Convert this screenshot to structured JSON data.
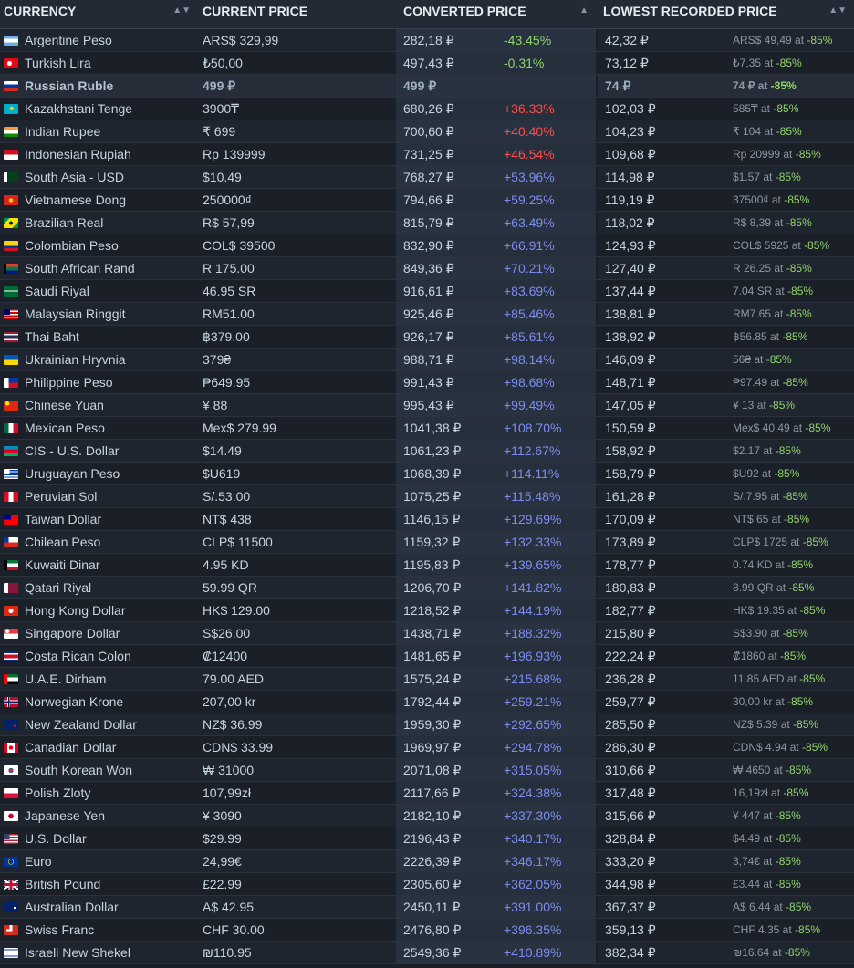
{
  "headers": {
    "currency": "CURRENCY",
    "current_price": "CURRENT PRICE",
    "converted_price": "CONVERTED PRICE",
    "lowest_recorded_price": "LOWEST RECORDED PRICE",
    "sort_both": "▲▼",
    "sort_asc": "▲"
  },
  "colors": {
    "discount_green": "#8fd46b",
    "increase_red": "#ff4d4d",
    "increase_blue": "#7d8cf0"
  },
  "rows": [
    {
      "flag": "argentina-flag",
      "currency": "Argentine Peso",
      "price": "ARS$ 329,99",
      "converted": "282,18 ₽",
      "diff": "-43.45%",
      "tone": "neg",
      "low": "42,32 ₽",
      "record": "ARS$ 49,49 at ",
      "disc": "-85%"
    },
    {
      "flag": "turkey-flag",
      "currency": "Turkish Lira",
      "price": "₺50,00",
      "converted": "497,43 ₽",
      "diff": "-0.31%",
      "tone": "neg",
      "low": "73,12 ₽",
      "record": "₺7,35 at ",
      "disc": "-85%"
    },
    {
      "flag": "russia-flag",
      "currency": "Russian Ruble",
      "price": "499 ₽",
      "converted": "499 ₽",
      "diff": "",
      "tone": "",
      "low": "74 ₽",
      "record": "74 ₽ at ",
      "disc": "-85%",
      "highlight": true
    },
    {
      "flag": "kazakhstan-flag",
      "currency": "Kazakhstani Tenge",
      "price": "3900₸",
      "converted": "680,26 ₽",
      "diff": "+36.33%",
      "tone": "pos",
      "low": "102,03 ₽",
      "record": "585₸ at ",
      "disc": "-85%"
    },
    {
      "flag": "india-flag",
      "currency": "Indian Rupee",
      "price": "₹ 699",
      "converted": "700,60 ₽",
      "diff": "+40.40%",
      "tone": "pos",
      "low": "104,23 ₽",
      "record": "₹ 104 at ",
      "disc": "-85%"
    },
    {
      "flag": "indonesia-flag",
      "currency": "Indonesian Rupiah",
      "price": "Rp 139999",
      "converted": "731,25 ₽",
      "diff": "+46.54%",
      "tone": "pos",
      "low": "109,68 ₽",
      "record": "Rp 20999 at ",
      "disc": "-85%"
    },
    {
      "flag": "pakistan-flag",
      "currency": "South Asia - USD",
      "price": "$10.49",
      "converted": "768,27 ₽",
      "diff": "+53.96%",
      "tone": "big",
      "low": "114,98 ₽",
      "record": "$1.57 at ",
      "disc": "-85%"
    },
    {
      "flag": "vietnam-flag",
      "currency": "Vietnamese Dong",
      "price": "250000₫",
      "converted": "794,66 ₽",
      "diff": "+59.25%",
      "tone": "big",
      "low": "119,19 ₽",
      "record": "37500₫ at ",
      "disc": "-85%"
    },
    {
      "flag": "brazil-flag",
      "currency": "Brazilian Real",
      "price": "R$ 57,99",
      "converted": "815,79 ₽",
      "diff": "+63.49%",
      "tone": "big",
      "low": "118,02 ₽",
      "record": "R$ 8,39 at ",
      "disc": "-85%"
    },
    {
      "flag": "colombia-flag",
      "currency": "Colombian Peso",
      "price": "COL$ 39500",
      "converted": "832,90 ₽",
      "diff": "+66.91%",
      "tone": "big",
      "low": "124,93 ₽",
      "record": "COL$ 5925 at ",
      "disc": "-85%"
    },
    {
      "flag": "south-africa-flag",
      "currency": "South African Rand",
      "price": "R 175.00",
      "converted": "849,36 ₽",
      "diff": "+70.21%",
      "tone": "big",
      "low": "127,40 ₽",
      "record": "R 26.25 at ",
      "disc": "-85%"
    },
    {
      "flag": "saudi-flag",
      "currency": "Saudi Riyal",
      "price": "46.95 SR",
      "converted": "916,61 ₽",
      "diff": "+83.69%",
      "tone": "big",
      "low": "137,44 ₽",
      "record": "7.04 SR at ",
      "disc": "-85%"
    },
    {
      "flag": "malaysia-flag",
      "currency": "Malaysian Ringgit",
      "price": "RM51.00",
      "converted": "925,46 ₽",
      "diff": "+85.46%",
      "tone": "big",
      "low": "138,81 ₽",
      "record": "RM7.65 at ",
      "disc": "-85%"
    },
    {
      "flag": "thailand-flag",
      "currency": "Thai Baht",
      "price": "฿379.00",
      "converted": "926,17 ₽",
      "diff": "+85.61%",
      "tone": "big",
      "low": "138,92 ₽",
      "record": "฿56.85 at ",
      "disc": "-85%"
    },
    {
      "flag": "ukraine-flag",
      "currency": "Ukrainian Hryvnia",
      "price": "379₴",
      "converted": "988,71 ₽",
      "diff": "+98.14%",
      "tone": "big",
      "low": "146,09 ₽",
      "record": "56₴ at ",
      "disc": "-85%"
    },
    {
      "flag": "philippines-flag",
      "currency": "Philippine Peso",
      "price": "₱649.95",
      "converted": "991,43 ₽",
      "diff": "+98.68%",
      "tone": "big",
      "low": "148,71 ₽",
      "record": "₱97.49 at ",
      "disc": "-85%"
    },
    {
      "flag": "china-flag",
      "currency": "Chinese Yuan",
      "price": "¥ 88",
      "converted": "995,43 ₽",
      "diff": "+99.49%",
      "tone": "big",
      "low": "147,05 ₽",
      "record": "¥ 13 at ",
      "disc": "-85%"
    },
    {
      "flag": "mexico-flag",
      "currency": "Mexican Peso",
      "price": "Mex$ 279.99",
      "converted": "1041,38 ₽",
      "diff": "+108.70%",
      "tone": "big",
      "low": "150,59 ₽",
      "record": "Mex$ 40.49 at ",
      "disc": "-85%"
    },
    {
      "flag": "azerbaijan-flag",
      "currency": "CIS - U.S. Dollar",
      "price": "$14.49",
      "converted": "1061,23 ₽",
      "diff": "+112.67%",
      "tone": "big",
      "low": "158,92 ₽",
      "record": "$2.17 at ",
      "disc": "-85%"
    },
    {
      "flag": "uruguay-flag",
      "currency": "Uruguayan Peso",
      "price": "$U619",
      "converted": "1068,39 ₽",
      "diff": "+114.11%",
      "tone": "big",
      "low": "158,79 ₽",
      "record": "$U92 at ",
      "disc": "-85%"
    },
    {
      "flag": "peru-flag",
      "currency": "Peruvian Sol",
      "price": "S/.53.00",
      "converted": "1075,25 ₽",
      "diff": "+115.48%",
      "tone": "big",
      "low": "161,28 ₽",
      "record": "S/.7.95 at ",
      "disc": "-85%"
    },
    {
      "flag": "taiwan-flag",
      "currency": "Taiwan Dollar",
      "price": "NT$ 438",
      "converted": "1146,15 ₽",
      "diff": "+129.69%",
      "tone": "big",
      "low": "170,09 ₽",
      "record": "NT$ 65 at ",
      "disc": "-85%"
    },
    {
      "flag": "chile-flag",
      "currency": "Chilean Peso",
      "price": "CLP$ 11500",
      "converted": "1159,32 ₽",
      "diff": "+132.33%",
      "tone": "big",
      "low": "173,89 ₽",
      "record": "CLP$ 1725 at ",
      "disc": "-85%"
    },
    {
      "flag": "kuwait-flag",
      "currency": "Kuwaiti Dinar",
      "price": "4.95 KD",
      "converted": "1195,83 ₽",
      "diff": "+139.65%",
      "tone": "big",
      "low": "178,77 ₽",
      "record": "0.74 KD at ",
      "disc": "-85%"
    },
    {
      "flag": "qatar-flag",
      "currency": "Qatari Riyal",
      "price": "59.99 QR",
      "converted": "1206,70 ₽",
      "diff": "+141.82%",
      "tone": "big",
      "low": "180,83 ₽",
      "record": "8.99 QR at ",
      "disc": "-85%"
    },
    {
      "flag": "hong-kong-flag",
      "currency": "Hong Kong Dollar",
      "price": "HK$ 129.00",
      "converted": "1218,52 ₽",
      "diff": "+144.19%",
      "tone": "big",
      "low": "182,77 ₽",
      "record": "HK$ 19.35 at ",
      "disc": "-85%"
    },
    {
      "flag": "singapore-flag",
      "currency": "Singapore Dollar",
      "price": "S$26.00",
      "converted": "1438,71 ₽",
      "diff": "+188.32%",
      "tone": "big",
      "low": "215,80 ₽",
      "record": "S$3.90 at ",
      "disc": "-85%"
    },
    {
      "flag": "costa-rica-flag",
      "currency": "Costa Rican Colon",
      "price": "₡12400",
      "converted": "1481,65 ₽",
      "diff": "+196.93%",
      "tone": "big",
      "low": "222,24 ₽",
      "record": "₡1860 at ",
      "disc": "-85%"
    },
    {
      "flag": "uae-flag",
      "currency": "U.A.E. Dirham",
      "price": "79.00 AED",
      "converted": "1575,24 ₽",
      "diff": "+215.68%",
      "tone": "big",
      "low": "236,28 ₽",
      "record": "11.85 AED at ",
      "disc": "-85%"
    },
    {
      "flag": "norway-flag",
      "currency": "Norwegian Krone",
      "price": "207,00 kr",
      "converted": "1792,44 ₽",
      "diff": "+259.21%",
      "tone": "big",
      "low": "259,77 ₽",
      "record": "30,00 kr at ",
      "disc": "-85%"
    },
    {
      "flag": "new-zealand-flag",
      "currency": "New Zealand Dollar",
      "price": "NZ$ 36.99",
      "converted": "1959,30 ₽",
      "diff": "+292.65%",
      "tone": "big",
      "low": "285,50 ₽",
      "record": "NZ$ 5.39 at ",
      "disc": "-85%"
    },
    {
      "flag": "canada-flag",
      "currency": "Canadian Dollar",
      "price": "CDN$ 33.99",
      "converted": "1969,97 ₽",
      "diff": "+294.78%",
      "tone": "big",
      "low": "286,30 ₽",
      "record": "CDN$ 4.94 at ",
      "disc": "-85%"
    },
    {
      "flag": "south-korea-flag",
      "currency": "South Korean Won",
      "price": "₩ 31000",
      "converted": "2071,08 ₽",
      "diff": "+315.05%",
      "tone": "big",
      "low": "310,66 ₽",
      "record": "₩ 4650 at ",
      "disc": "-85%"
    },
    {
      "flag": "poland-flag",
      "currency": "Polish Zloty",
      "price": "107,99zł",
      "converted": "2117,66 ₽",
      "diff": "+324.38%",
      "tone": "big",
      "low": "317,48 ₽",
      "record": "16,19zł at ",
      "disc": "-85%"
    },
    {
      "flag": "japan-flag",
      "currency": "Japanese Yen",
      "price": "¥ 3090",
      "converted": "2182,10 ₽",
      "diff": "+337.30%",
      "tone": "big",
      "low": "315,66 ₽",
      "record": "¥ 447 at ",
      "disc": "-85%"
    },
    {
      "flag": "usa-flag",
      "currency": "U.S. Dollar",
      "price": "$29.99",
      "converted": "2196,43 ₽",
      "diff": "+340.17%",
      "tone": "big",
      "low": "328,84 ₽",
      "record": "$4.49 at ",
      "disc": "-85%"
    },
    {
      "flag": "eu-flag",
      "currency": "Euro",
      "price": "24,99€",
      "converted": "2226,39 ₽",
      "diff": "+346.17%",
      "tone": "big",
      "low": "333,20 ₽",
      "record": "3,74€ at ",
      "disc": "-85%"
    },
    {
      "flag": "uk-flag",
      "currency": "British Pound",
      "price": "£22.99",
      "converted": "2305,60 ₽",
      "diff": "+362.05%",
      "tone": "big",
      "low": "344,98 ₽",
      "record": "£3.44 at ",
      "disc": "-85%"
    },
    {
      "flag": "australia-flag",
      "currency": "Australian Dollar",
      "price": "A$ 42.95",
      "converted": "2450,11 ₽",
      "diff": "+391.00%",
      "tone": "big",
      "low": "367,37 ₽",
      "record": "A$ 6.44 at ",
      "disc": "-85%"
    },
    {
      "flag": "switzerland-flag",
      "currency": "Swiss Franc",
      "price": "CHF 30.00",
      "converted": "2476,80 ₽",
      "diff": "+396.35%",
      "tone": "big",
      "low": "359,13 ₽",
      "record": "CHF 4.35 at ",
      "disc": "-85%"
    },
    {
      "flag": "israel-flag",
      "currency": "Israeli New Shekel",
      "price": "₪110.95",
      "converted": "2549,36 ₽",
      "diff": "+410.89%",
      "tone": "big",
      "low": "382,34 ₽",
      "record": "₪16.64 at ",
      "disc": "-85%"
    }
  ]
}
